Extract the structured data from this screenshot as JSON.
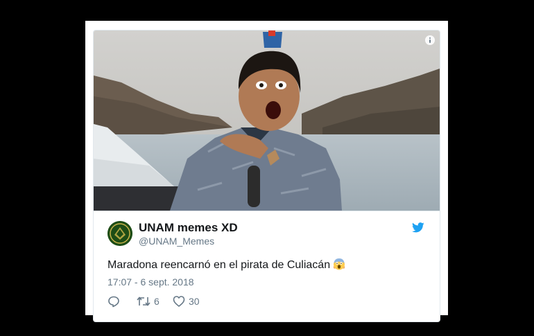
{
  "tweet": {
    "display_name": "UNAM memes XD",
    "handle": "@UNAM_Memes",
    "text": "Maradona reencarnó en el pirata de Culiacán",
    "emoji": "face-screaming-in-fear",
    "timestamp": "17:07 - 6 sept. 2018",
    "retweet_count": "6",
    "like_count": "30"
  },
  "icons": {
    "info": "info-icon",
    "brand": "twitter-bird-icon",
    "reply": "reply-icon",
    "retweet": "retweet-icon",
    "like": "heart-icon"
  },
  "colors": {
    "twitter_blue": "#1da1f2",
    "text_primary": "#14171a",
    "text_secondary": "#657786",
    "border": "#e1e8ed"
  }
}
